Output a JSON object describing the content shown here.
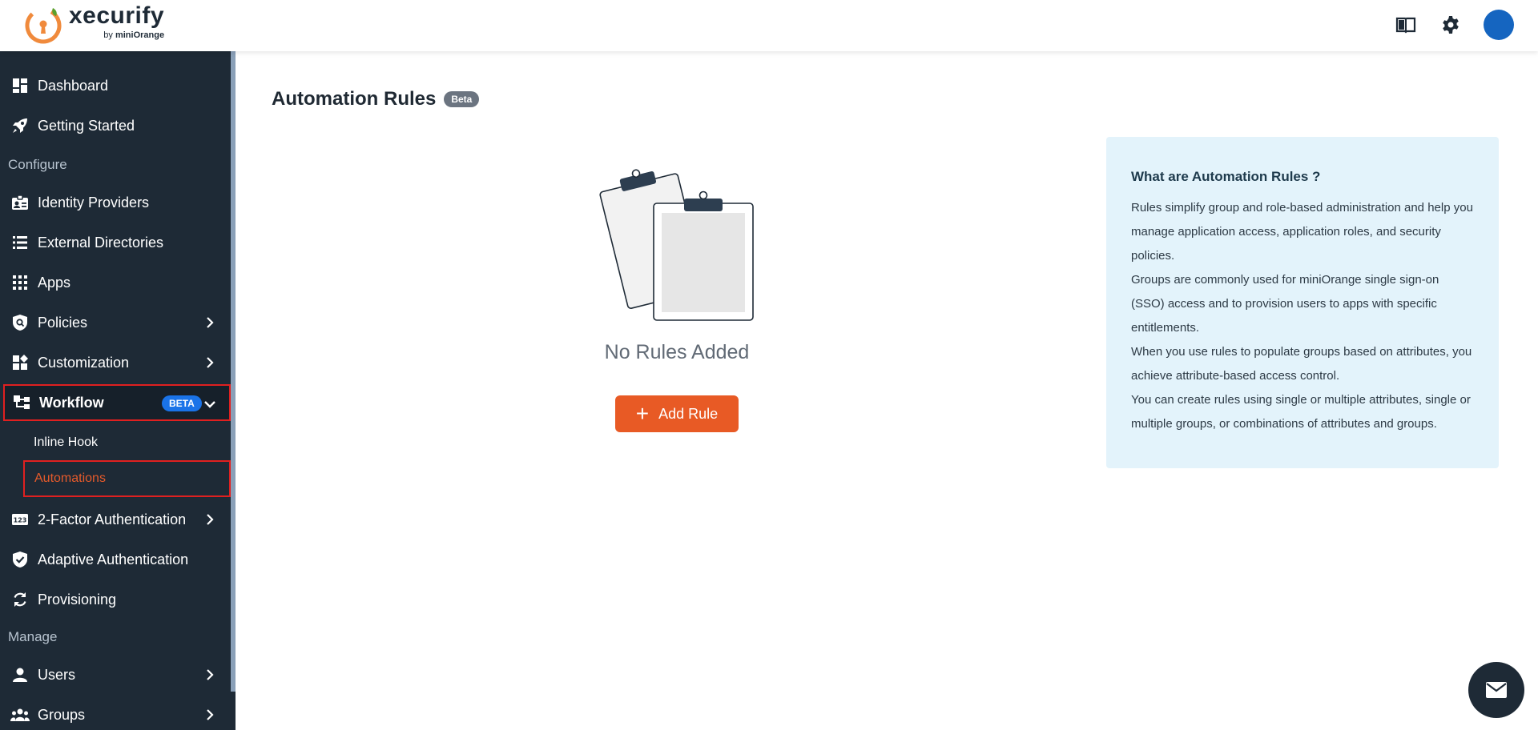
{
  "brand": {
    "name": "xecurify",
    "by": "by",
    "org": "miniOrange"
  },
  "sidebar": {
    "items": [
      {
        "label": "Dashboard"
      },
      {
        "label": "Getting Started"
      },
      {
        "label": "Identity Providers"
      },
      {
        "label": "External Directories"
      },
      {
        "label": "Apps"
      },
      {
        "label": "Policies"
      },
      {
        "label": "Customization"
      },
      {
        "label": "Workflow",
        "badge": "BETA"
      },
      {
        "label": "2-Factor Authentication"
      },
      {
        "label": "Adaptive Authentication"
      },
      {
        "label": "Provisioning"
      },
      {
        "label": "Users"
      },
      {
        "label": "Groups"
      }
    ],
    "sections": {
      "configure": "Configure",
      "manage": "Manage"
    },
    "workflow_sub": {
      "inline_hook": "Inline Hook",
      "automations": "Automations"
    }
  },
  "main": {
    "title": "Automation Rules",
    "title_badge": "Beta",
    "empty_text": "No Rules Added",
    "add_button": "Add Rule"
  },
  "info": {
    "title": "What are Automation Rules ?",
    "paragraphs": [
      "Rules simplify group and role-based administration and help you manage application access, application roles, and security policies.",
      "Groups are commonly used for miniOrange single sign-on (SSO) access and to provision users to apps with specific entitlements.",
      "When you use rules to populate groups based on attributes, you achieve attribute-based access control.",
      "You can create rules using single or multiple attributes, single or multiple groups, or combinations of attributes and groups."
    ]
  },
  "colors": {
    "sidebar": "#1e2a36",
    "accent": "#e85a25",
    "info_bg": "#e3f3fb",
    "avatar": "#1565c0",
    "beta_blue": "#1a73e8"
  }
}
